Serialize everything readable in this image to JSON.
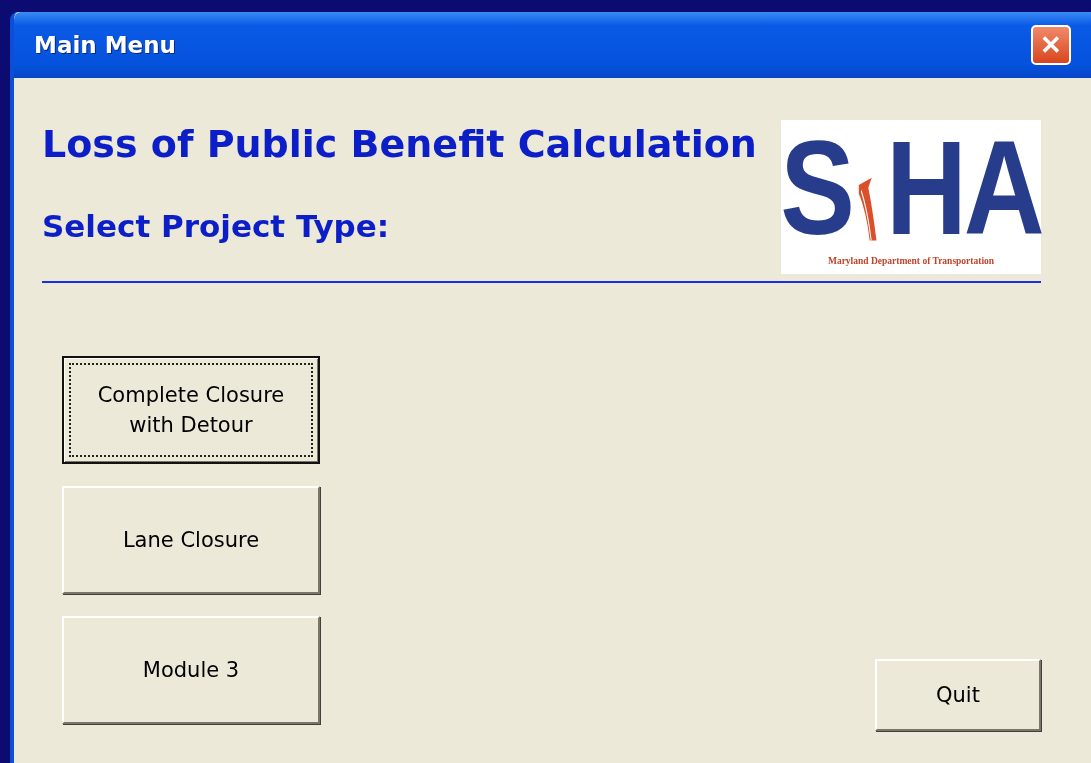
{
  "window": {
    "title": "Main Menu",
    "close_button": "✕"
  },
  "heading": "Loss of Public Benefit Calculation",
  "subheading": "Select Project Type:",
  "logo": {
    "letters": [
      "S",
      "HA"
    ],
    "caption": "Maryland Department of Transportation"
  },
  "project_buttons": [
    {
      "label": "Complete Closure\nwith Detour",
      "focused": true
    },
    {
      "label": "Lane Closure",
      "focused": false
    },
    {
      "label": "Module 3",
      "focused": false
    }
  ],
  "quit_button": {
    "label": "Quit",
    "focused": false
  }
}
